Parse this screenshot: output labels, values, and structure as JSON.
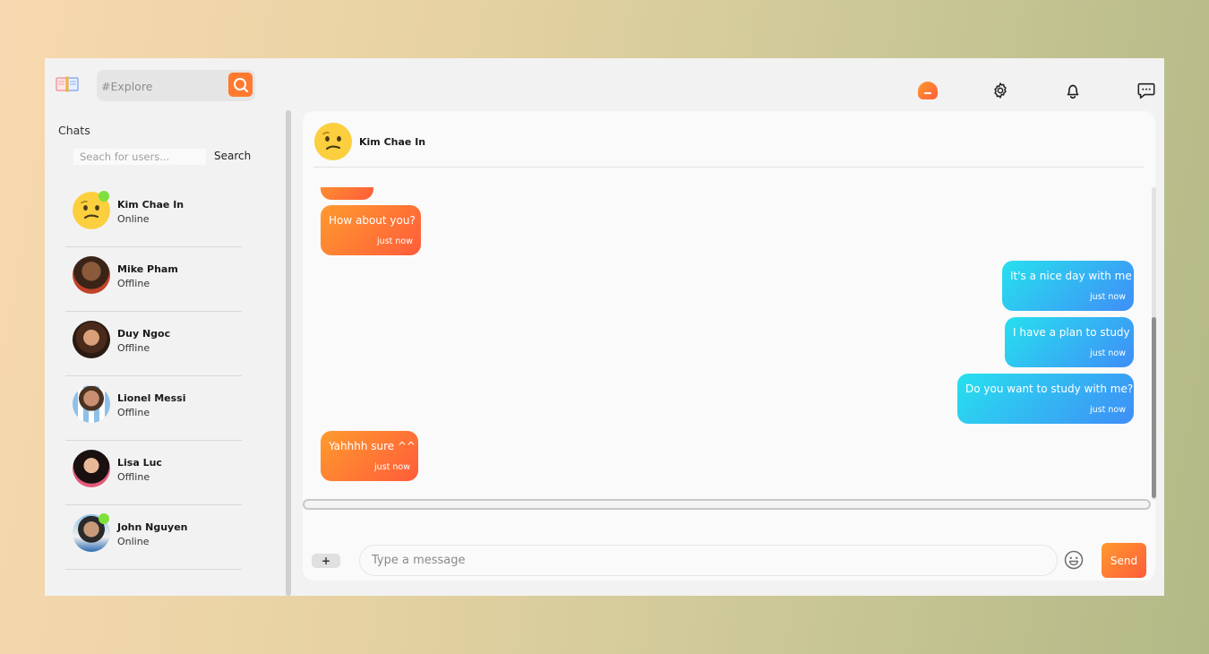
{
  "header": {
    "logo_icon": "book-icon",
    "explore": {
      "placeholder": "#Explore",
      "button_icon": "search-icon"
    },
    "icons": [
      "profile-avatar-icon",
      "gear-icon",
      "bell-icon",
      "message-icon"
    ]
  },
  "sidebar": {
    "title": "Chats",
    "search_placeholder": "Seach for users...",
    "search_button": "Search",
    "contacts": [
      {
        "name": "Kim Chae In",
        "status": "Online",
        "avatar": "confused-emoji"
      },
      {
        "name": "Mike Pham",
        "status": "Offline",
        "avatar": "photo"
      },
      {
        "name": "Duy Ngoc",
        "status": "Offline",
        "avatar": "photo"
      },
      {
        "name": "Lionel Messi",
        "status": "Offline",
        "avatar": "photo"
      },
      {
        "name": "Lisa Luc",
        "status": "Offline",
        "avatar": "photo"
      },
      {
        "name": "John Nguyen",
        "status": "Online",
        "avatar": "photo"
      }
    ]
  },
  "chat": {
    "name": "Kim Chae In",
    "messages": [
      {
        "dir": "in",
        "text": "How about you?",
        "time": "just now"
      },
      {
        "dir": "out",
        "text": "It's a nice day with me",
        "time": "just now"
      },
      {
        "dir": "out",
        "text": "I have a plan to study",
        "time": "just now"
      },
      {
        "dir": "out",
        "text": "Do you want to study with me?",
        "time": "just now"
      },
      {
        "dir": "in",
        "text": "Yahhhh sure ^^",
        "time": "just now"
      }
    ]
  },
  "composer": {
    "plus": "+",
    "placeholder": "Type a message",
    "emoji_icon": "smiley-icon",
    "send": "Send"
  },
  "colors": {
    "accent_orange": "#ff7a2e",
    "online_dot": "#7ee03a",
    "outgoing_start": "#27e0ee",
    "outgoing_end": "#3f8ef7"
  }
}
